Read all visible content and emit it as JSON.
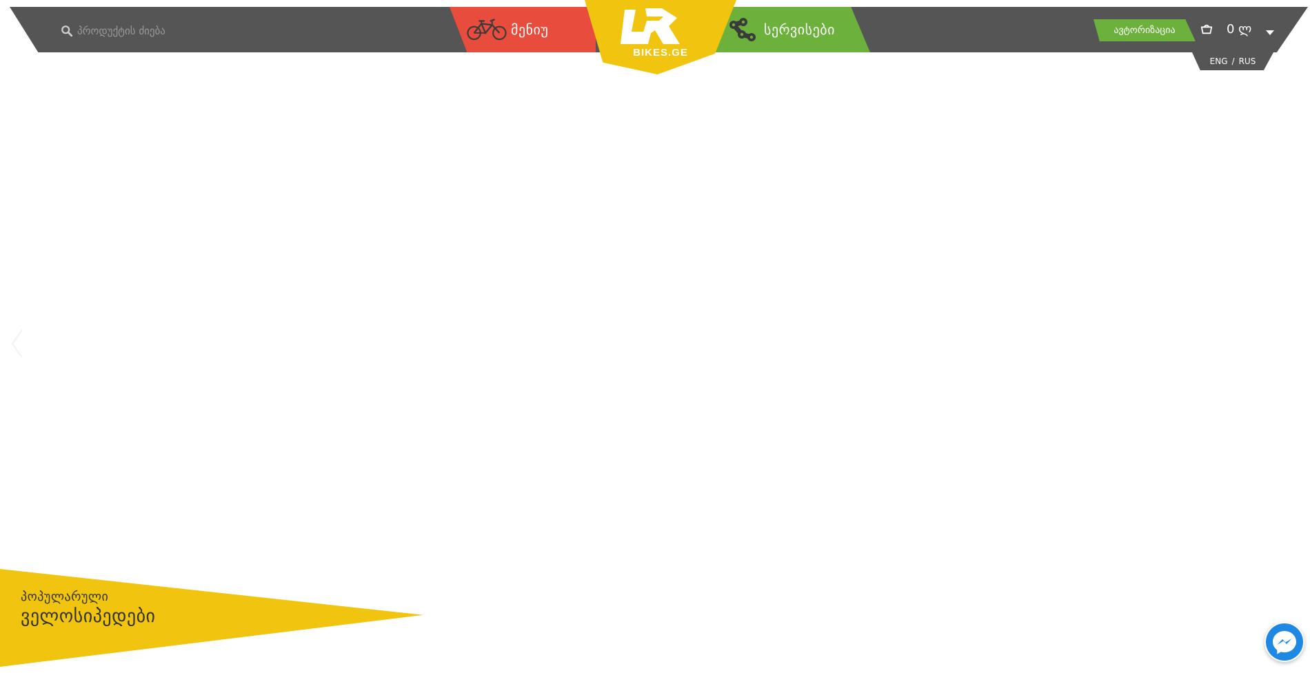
{
  "header": {
    "search": {
      "placeholder": "პროდუქტის ძიება",
      "icon": "search-icon"
    },
    "menu": {
      "label": "მენიუ",
      "icon": "bicycle-icon",
      "color": "#e84c3d"
    },
    "logo": {
      "text": "BIKES.GE",
      "color": "#f1c40f"
    },
    "services": {
      "label": "სერვისები",
      "icon": "bike-chain-icon",
      "color": "#6cb13b"
    },
    "auth": {
      "label": "ავტორიზაცია",
      "color": "#6cb13b"
    },
    "cart": {
      "icon": "shopping-basket-icon",
      "total": "0 ლ"
    },
    "languages": {
      "eng": "ENG",
      "separator": "/",
      "rus": "RUS"
    },
    "bar_color": "#555555"
  },
  "slider": {
    "prev_icon": "chevron-left-icon"
  },
  "popular": {
    "line1": "პოპულარული",
    "line2": "ველოსიპედები",
    "color": "#f1c40f"
  },
  "messenger": {
    "icon": "messenger-icon",
    "color": "#1e88e5"
  }
}
